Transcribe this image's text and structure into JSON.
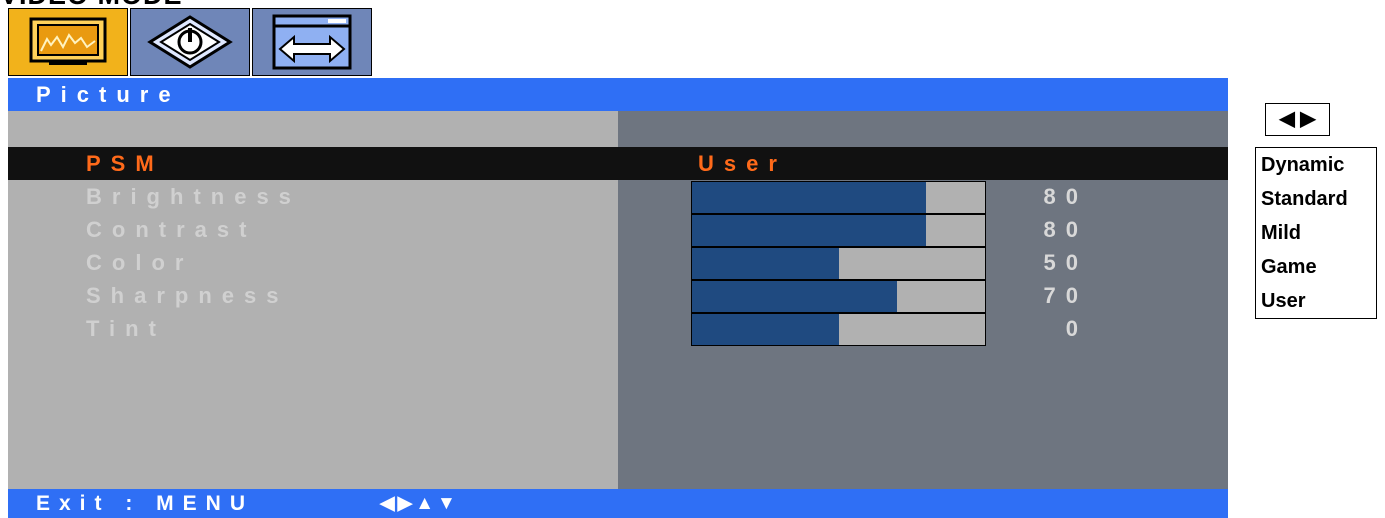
{
  "mode_title": "VIDEO MODE",
  "tabs": [
    {
      "icon": "tv-picture-icon",
      "active": true
    },
    {
      "icon": "power-sound-icon",
      "active": false
    },
    {
      "icon": "screen-size-icon",
      "active": false
    }
  ],
  "menu": {
    "title": "Picture",
    "rows": [
      {
        "label": "PSM",
        "value": "User",
        "highlighted": true
      },
      {
        "label": "Brightness",
        "level": 80,
        "number": "80"
      },
      {
        "label": "Contrast",
        "level": 80,
        "number": "80"
      },
      {
        "label": "Color",
        "level": 50,
        "number": "50"
      },
      {
        "label": "Sharpness",
        "level": 70,
        "number": "70"
      },
      {
        "label": "Tint",
        "level": 50,
        "number": "0"
      }
    ]
  },
  "footer": {
    "exit": "Exit : MENU",
    "nav_arrows": "◀▶▲▼"
  },
  "side": {
    "toggle": "◀ ▶",
    "options": [
      "Dynamic",
      "Standard",
      "Mild",
      "Game",
      "User"
    ]
  },
  "colors": {
    "title_blue": "#2f6ff5",
    "selected_orange": "#ff6a1a",
    "bar_fill": "#1f4a80",
    "active_tab": "#f2b21b"
  }
}
